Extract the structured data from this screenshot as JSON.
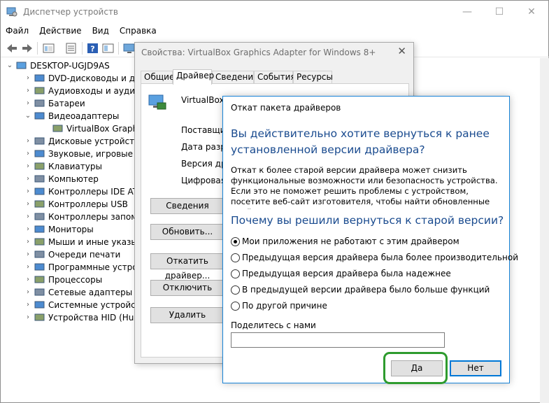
{
  "window": {
    "title": "Диспетчер устройств",
    "minimize": "—",
    "maximize": "☐",
    "close": "✕"
  },
  "menu": [
    "Файл",
    "Действие",
    "Вид",
    "Справка"
  ],
  "tree": {
    "root": "DESKTOP-UGJD9AS",
    "items": [
      {
        "label": "DVD-дисководы и диск",
        "expanded": false,
        "child": false
      },
      {
        "label": "Аудиовходы и аудиовы",
        "expanded": false,
        "child": false
      },
      {
        "label": "Батареи",
        "expanded": false,
        "child": false
      },
      {
        "label": "Видеоадаптеры",
        "expanded": true,
        "child": false
      },
      {
        "label": "VirtualBox Graphics A",
        "expanded": false,
        "child": true
      },
      {
        "label": "Дисковые устройства",
        "expanded": false,
        "child": false
      },
      {
        "label": "Звуковые, игровые и в",
        "expanded": false,
        "child": false
      },
      {
        "label": "Клавиатуры",
        "expanded": false,
        "child": false
      },
      {
        "label": "Компьютер",
        "expanded": false,
        "child": false
      },
      {
        "label": "Контроллеры IDE ATA/",
        "expanded": false,
        "child": false
      },
      {
        "label": "Контроллеры USB",
        "expanded": false,
        "child": false
      },
      {
        "label": "Контроллеры запомин",
        "expanded": false,
        "child": false
      },
      {
        "label": "Мониторы",
        "expanded": false,
        "child": false
      },
      {
        "label": "Мыши и иные указыва",
        "expanded": false,
        "child": false
      },
      {
        "label": "Очереди печати",
        "expanded": false,
        "child": false
      },
      {
        "label": "Программные устройс",
        "expanded": false,
        "child": false
      },
      {
        "label": "Процессоры",
        "expanded": false,
        "child": false
      },
      {
        "label": "Сетевые адаптеры",
        "expanded": false,
        "child": false
      },
      {
        "label": "Системные устройства",
        "expanded": false,
        "child": false
      },
      {
        "label": "Устройства HID (Huma",
        "expanded": false,
        "child": false
      }
    ]
  },
  "properties": {
    "title": "Свойства: VirtualBox Graphics Adapter for Windows 8+",
    "close": "✕",
    "tabs": [
      "Общие",
      "Драйвер",
      "Сведения",
      "События",
      "Ресурсы"
    ],
    "active_tab": "Драйвер",
    "device_name": "VirtualBox G",
    "labels": [
      "Поставщик",
      "Дата разра",
      "Версия дра",
      "Цифровая п"
    ],
    "buttons": [
      "Сведения",
      "Обновить...",
      "Откатить драйвер...",
      "Отключить",
      "Удалить"
    ]
  },
  "rollback": {
    "title": "Откат пакета драйверов",
    "question1": "Вы действительно хотите вернуться к ранее установленной версии драйвера?",
    "description": "Откат к более старой версии драйвера может снизить функциональные возможности или безопасность устройства. Если это не поможет решить проблемы с устройством, посетите веб-сайт изготовителя, чтобы найти обновленные драйверы.",
    "question2": "Почему вы решили вернуться к старой версии?",
    "reasons": [
      "Мои приложения не работают с этим драйвером",
      "Предыдущая версия драйвера была более производительной",
      "Предыдущая версия драйвера была надежнее",
      "В предыдущей версии драйвера было больше функций",
      "По другой причине"
    ],
    "selected_reason": 0,
    "share_label": "Поделитесь с нами",
    "share_value": "",
    "yes": "Да",
    "no": "Нет"
  },
  "colors": {
    "accent": "#0078d7",
    "heading": "#1a4b8f",
    "highlight": "#2e9b2e"
  }
}
